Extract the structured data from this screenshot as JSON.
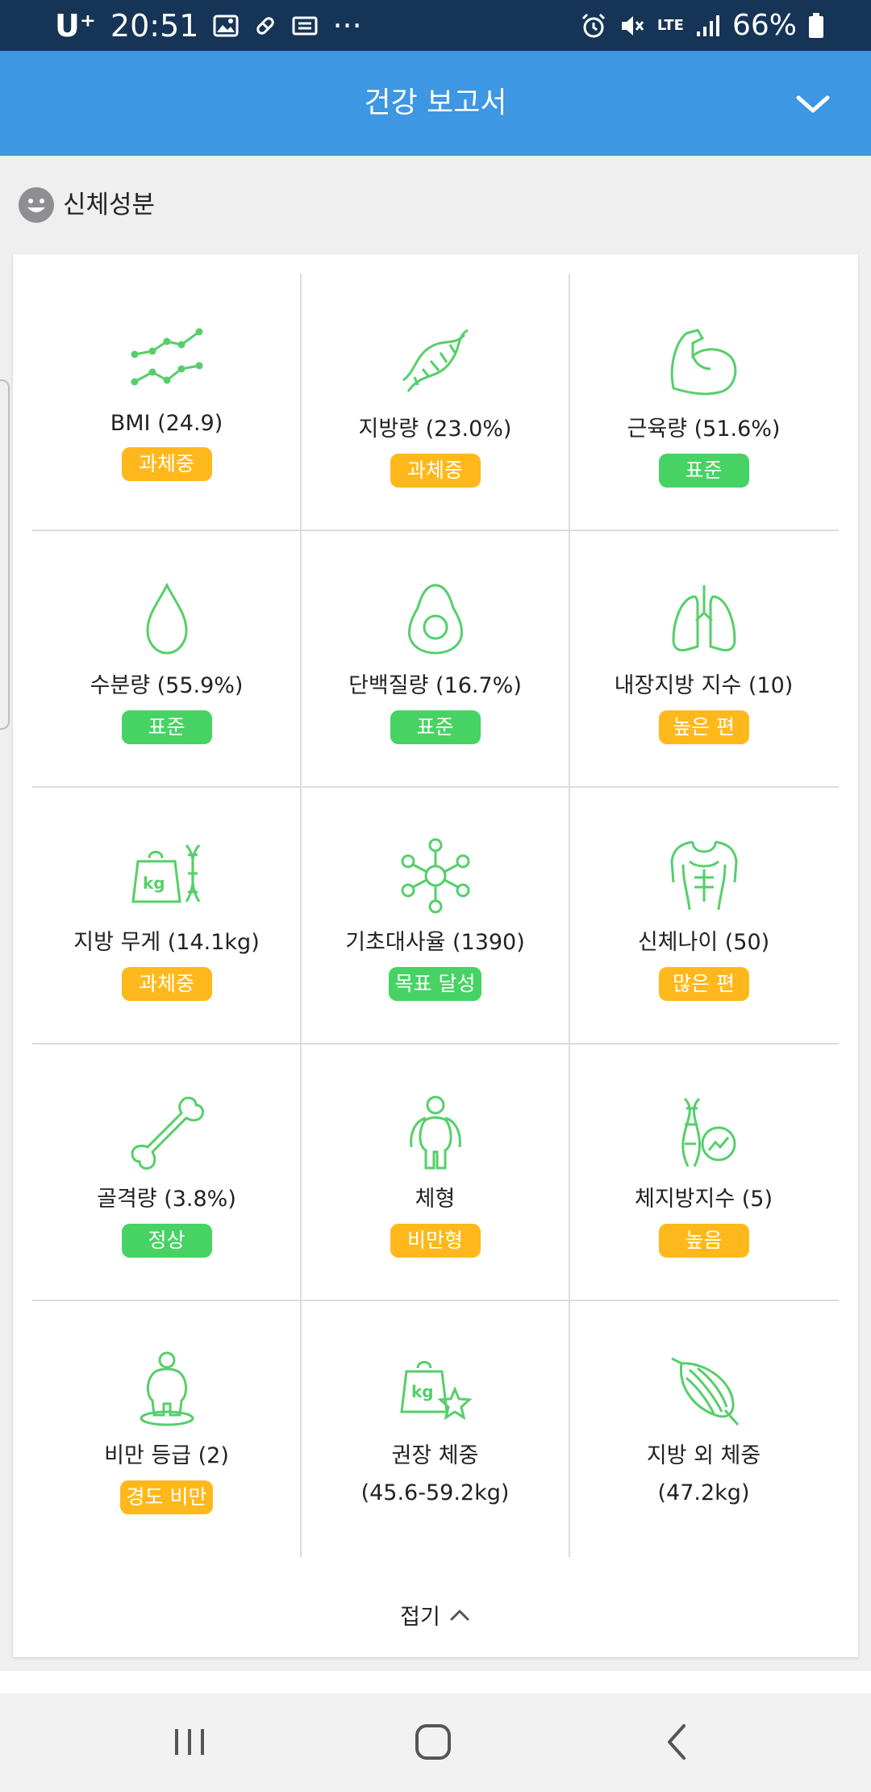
{
  "status_bar": {
    "carrier": "U⁺",
    "time": "20:51",
    "more": "···",
    "network": "LTE",
    "battery": "66%"
  },
  "header": {
    "title": "건강 보고서"
  },
  "section": {
    "title": "신체성분"
  },
  "colors": {
    "accent_blue": "#3d97e2",
    "status_bar": "#163456",
    "icon_green": "#55cf6a",
    "badge_orange": "#ffb81c",
    "badge_green": "#47d264"
  },
  "metrics": [
    {
      "icon": "bmi-chart-icon",
      "label": "BMI (24.9)",
      "badge": "과체중",
      "badge_color": "#ffb81c"
    },
    {
      "icon": "dna-icon",
      "label": "지방량 (23.0%)",
      "badge": "과체중",
      "badge_color": "#ffb81c"
    },
    {
      "icon": "muscle-arm-icon",
      "label": "근육량 (51.6%)",
      "badge": "표준",
      "badge_color": "#47d264"
    },
    {
      "icon": "water-drop-icon",
      "label": "수분량 (55.9%)",
      "badge": "표준",
      "badge_color": "#47d264"
    },
    {
      "icon": "avocado-icon",
      "label": "단백질량 (16.7%)",
      "badge": "표준",
      "badge_color": "#47d264"
    },
    {
      "icon": "lungs-icon",
      "label": "내장지방 지수 (10)",
      "badge": "높은 편",
      "badge_color": "#ffb81c"
    },
    {
      "icon": "weight-kg-dna-icon",
      "label": "지방 무게 (14.1kg)",
      "badge": "과체중",
      "badge_color": "#ffb81c"
    },
    {
      "icon": "molecule-icon",
      "label": "기초대사율 (1390)",
      "badge": "목표 달성",
      "badge_color": "#47d264"
    },
    {
      "icon": "torso-icon",
      "label": "신체나이 (50)",
      "badge": "많은 편",
      "badge_color": "#ffb81c"
    },
    {
      "icon": "bone-icon",
      "label": "골격량 (3.8%)",
      "badge": "정상",
      "badge_color": "#47d264"
    },
    {
      "icon": "body-shape-icon",
      "label": "체형",
      "badge": "비만형",
      "badge_color": "#ffb81c"
    },
    {
      "icon": "dna-chart-icon",
      "label": "체지방지수 (5)",
      "badge": "높음",
      "badge_color": "#ffb81c"
    },
    {
      "icon": "obesity-person-icon",
      "label": "비만 등급 (2)",
      "badge": "경도 비만",
      "badge_color": "#ffb81c"
    },
    {
      "icon": "weight-kg-star-icon",
      "label": "권장 체중",
      "sub": "(45.6-59.2kg)"
    },
    {
      "icon": "muscle-fiber-icon",
      "label": "지방 외 체중",
      "sub": "(47.2kg)"
    }
  ],
  "fold": {
    "label": "접기"
  }
}
